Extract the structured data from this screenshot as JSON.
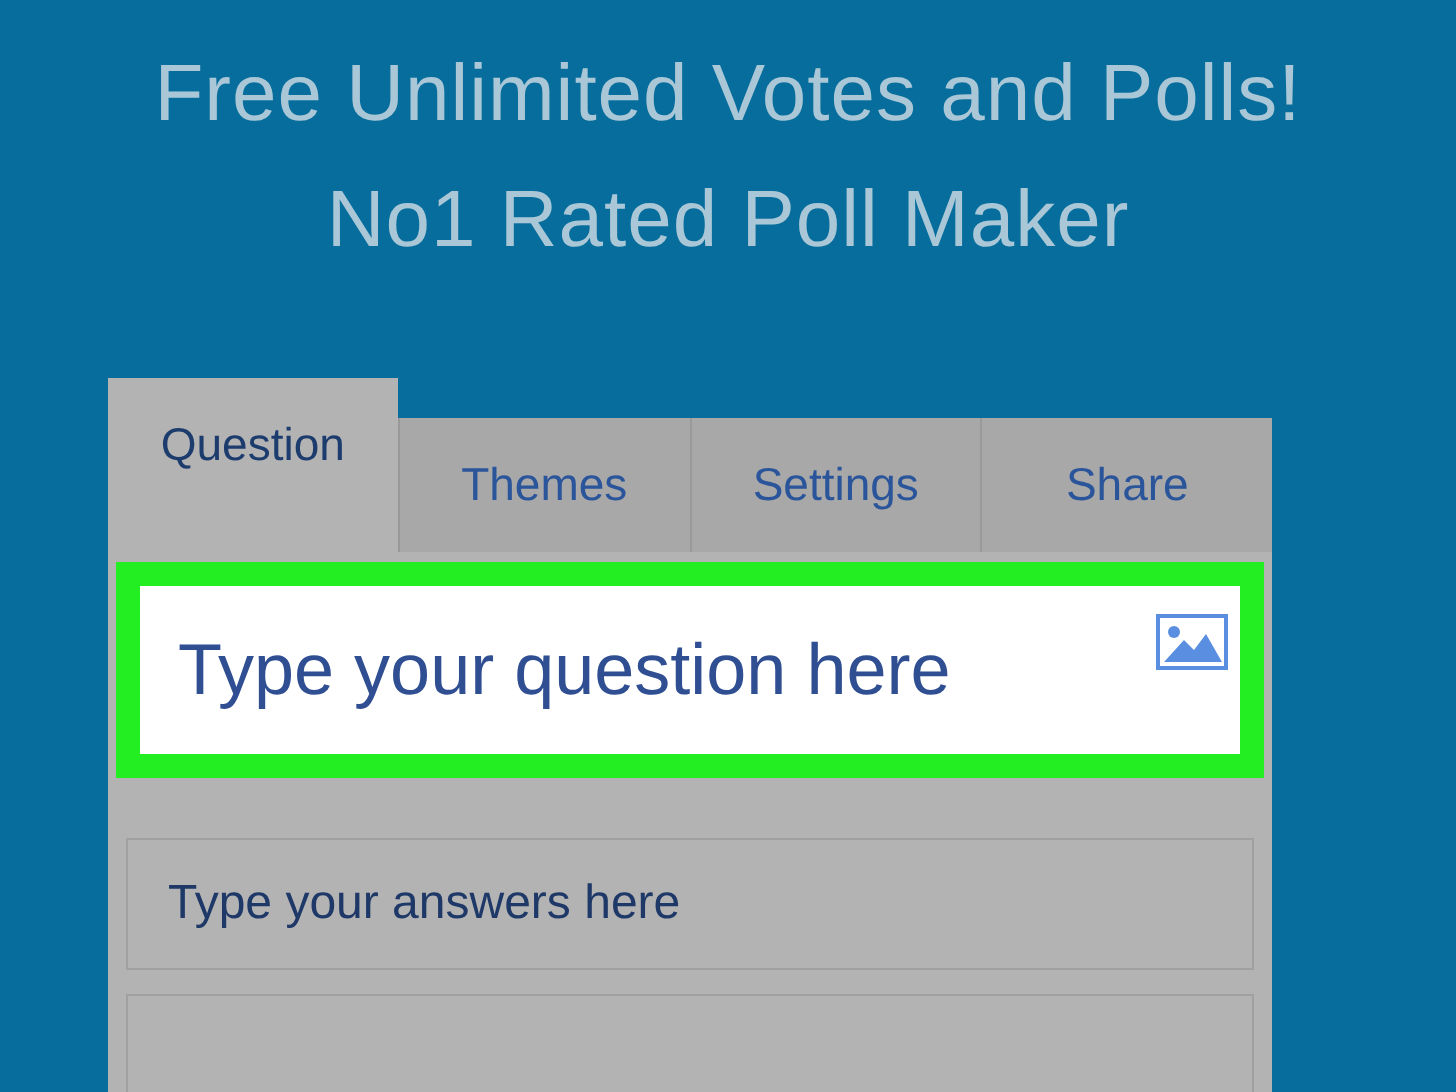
{
  "headline": [
    "Free Unlimited Votes and Polls!",
    "No1 Rated Poll Maker"
  ],
  "tabs": [
    {
      "label": "Question",
      "selected": true
    },
    {
      "label": "Themes",
      "selected": false
    },
    {
      "label": "Settings",
      "selected": false
    },
    {
      "label": "Share",
      "selected": false
    }
  ],
  "question": {
    "placeholder": "Type your question here"
  },
  "answers": [
    {
      "kind": "filled",
      "placeholder": "Type your answers here"
    },
    {
      "kind": "empty"
    }
  ]
}
